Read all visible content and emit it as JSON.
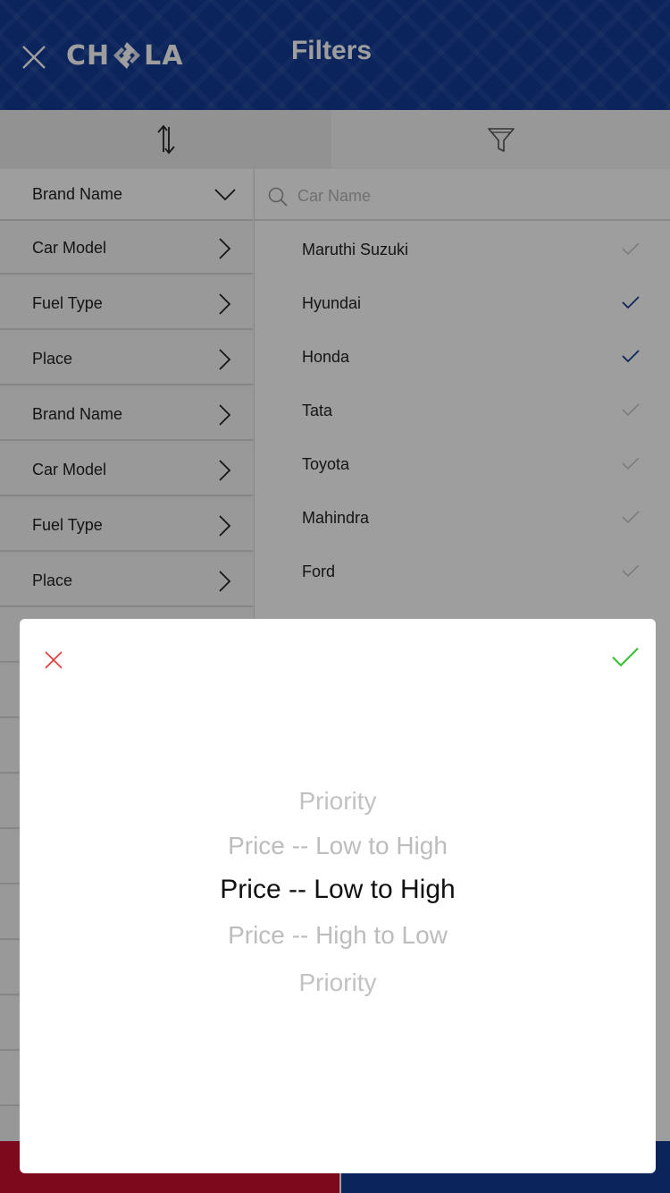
{
  "header": {
    "title": "Filters",
    "logo_text_left": "CH",
    "logo_text_right": "LA",
    "close_icon": "close-icon"
  },
  "tabs": [
    {
      "name": "sort",
      "icon": "sort-arrows-icon"
    },
    {
      "name": "filter",
      "icon": "funnel-icon"
    }
  ],
  "left_menu": {
    "items": [
      {
        "label": "Brand Name",
        "icon": "chevron-down-icon"
      },
      {
        "label": "Car Model",
        "icon": "chevron-right-icon"
      },
      {
        "label": "Fuel Type",
        "icon": "chevron-right-icon"
      },
      {
        "label": "Place",
        "icon": "chevron-right-icon"
      },
      {
        "label": "Brand Name",
        "icon": "chevron-right-icon"
      },
      {
        "label": "Car Model",
        "icon": "chevron-right-icon"
      },
      {
        "label": "Fuel Type",
        "icon": "chevron-right-icon"
      },
      {
        "label": "Place",
        "icon": "chevron-right-icon"
      }
    ]
  },
  "search": {
    "placeholder": "Car Name",
    "value": ""
  },
  "brands": [
    {
      "label": "Maruthi Suzuki",
      "checked": false
    },
    {
      "label": "Hyundai",
      "checked": true
    },
    {
      "label": "Honda",
      "checked": true
    },
    {
      "label": "Tata",
      "checked": false
    },
    {
      "label": "Toyota",
      "checked": false
    },
    {
      "label": "Mahindra",
      "checked": false
    },
    {
      "label": "Ford",
      "checked": false
    }
  ],
  "sort_modal": {
    "options": [
      "Priority",
      "Price -- Low to High",
      "Price -- Low to High",
      "Price -- High to Low",
      "Priority"
    ],
    "selected_index": 2,
    "cancel_icon": "close-icon",
    "confirm_icon": "check-icon"
  },
  "colors": {
    "brand_blue": "#123b94",
    "brand_red": "#c8102e",
    "check_blue": "#1a3d8f",
    "confirm_green": "#3cc13b",
    "cancel_red": "#e53935"
  }
}
